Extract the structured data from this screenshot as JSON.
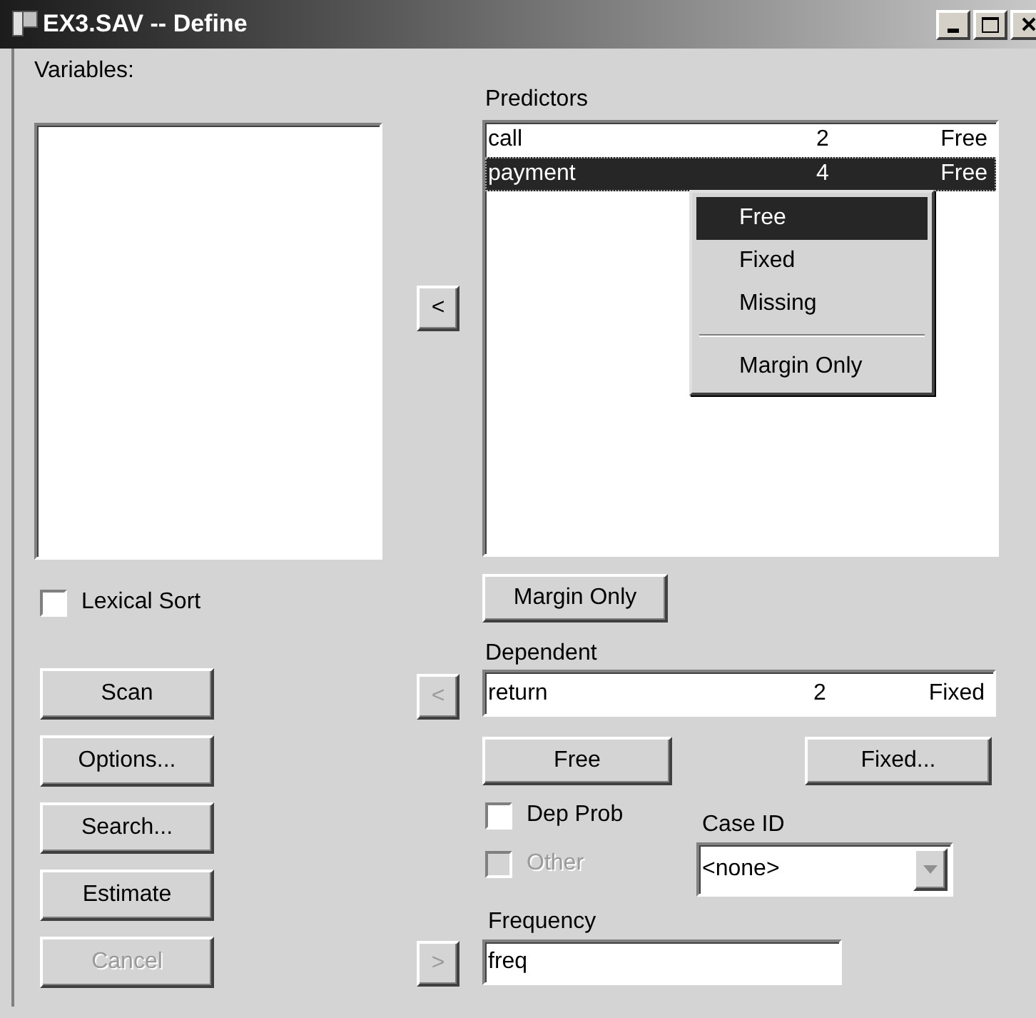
{
  "window": {
    "title": "EX3.SAV -- Define"
  },
  "variables": {
    "label": "Variables:"
  },
  "lexical_sort": {
    "label": "Lexical Sort",
    "checked": false
  },
  "actions": [
    {
      "label": "Scan",
      "disabled": false
    },
    {
      "label": "Options...",
      "disabled": false
    },
    {
      "label": "Search...",
      "disabled": false
    },
    {
      "label": "Estimate",
      "disabled": false
    },
    {
      "label": "Cancel",
      "disabled": true
    }
  ],
  "arrows": [
    {
      "symbol": "<",
      "disabled": false
    },
    {
      "symbol": "<",
      "disabled": true
    },
    {
      "symbol": ">",
      "disabled": true
    }
  ],
  "predictors": {
    "label": "Predictors",
    "rows": [
      {
        "name": "call",
        "column_2": "2",
        "status": "Free",
        "selected": false
      },
      {
        "name": "payment",
        "column_2": "4",
        "status": "Free",
        "selected": true
      }
    ]
  },
  "context_menu": [
    {
      "kind": "item",
      "label": "Free",
      "selected": true
    },
    {
      "kind": "item",
      "label": "Fixed",
      "selected": false
    },
    {
      "kind": "item",
      "label": "Missing",
      "selected": false
    },
    {
      "kind": "separator"
    },
    {
      "kind": "item",
      "label": "Margin Only",
      "selected": false
    }
  ],
  "margin_only_button": {
    "label": "Margin Only"
  },
  "dependent": {
    "label": "Dependent",
    "name": "return",
    "column_2": "2",
    "status": "Fixed"
  },
  "free_button": {
    "label": "Free"
  },
  "fixed_button": {
    "label": "Fixed..."
  },
  "dep_prob": {
    "label": "Dep Prob",
    "checked": false,
    "disabled": false
  },
  "other": {
    "label": "Other",
    "checked": false,
    "disabled": true
  },
  "case_id": {
    "label": "Case ID",
    "value": "<none>"
  },
  "frequency": {
    "label": "Frequency",
    "value": "freq"
  }
}
